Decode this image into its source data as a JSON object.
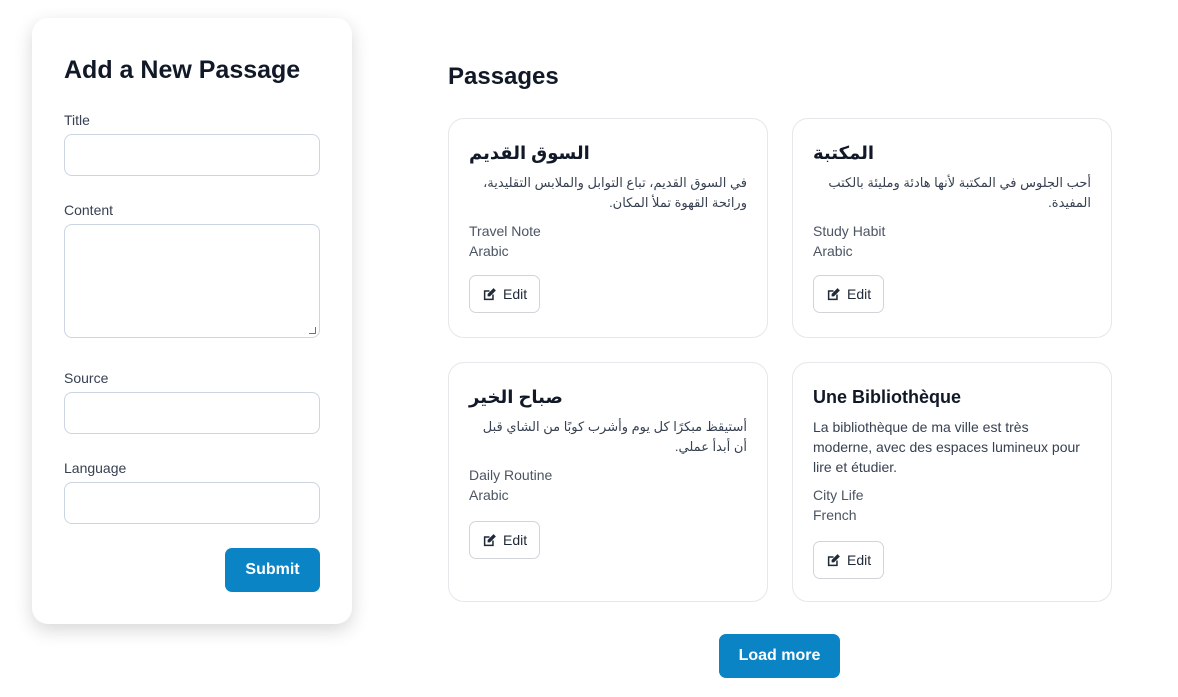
{
  "form": {
    "title": "Add a New Passage",
    "fields": {
      "title": {
        "label": "Title",
        "value": ""
      },
      "content": {
        "label": "Content",
        "value": ""
      },
      "source": {
        "label": "Source",
        "value": ""
      },
      "language": {
        "label": "Language",
        "value": ""
      }
    },
    "submit_label": "Submit"
  },
  "passages": {
    "heading": "Passages",
    "items": [
      {
        "title": "السوق القديم",
        "content": "في السوق القديم، تباع التوابل والملابس التقليدية، ورائحة القهوة تملأ المكان.",
        "source": "Travel Note",
        "language": "Arabic",
        "edit_label": "Edit"
      },
      {
        "title": "المكتبة",
        "content": "أحب الجلوس في المكتبة لأنها هادئة ومليئة بالكتب المفيدة.",
        "source": "Study Habit",
        "language": "Arabic",
        "edit_label": "Edit"
      },
      {
        "title": "صباح الخير",
        "content": "أستيقظ مبكرًا كل يوم وأشرب كوبًا من الشاي قبل أن أبدأ عملي.",
        "source": "Daily Routine",
        "language": "Arabic",
        "edit_label": "Edit"
      },
      {
        "title": "Une Bibliothèque",
        "content": "La bibliothèque de ma ville est très moderne, avec des espaces lumineux pour lire et étudier.",
        "source": "City Life",
        "language": "French",
        "edit_label": "Edit"
      }
    ],
    "load_more_label": "Load more"
  },
  "icons": {
    "edit": "edit-icon"
  },
  "colors": {
    "primary": "#0b84c6"
  }
}
